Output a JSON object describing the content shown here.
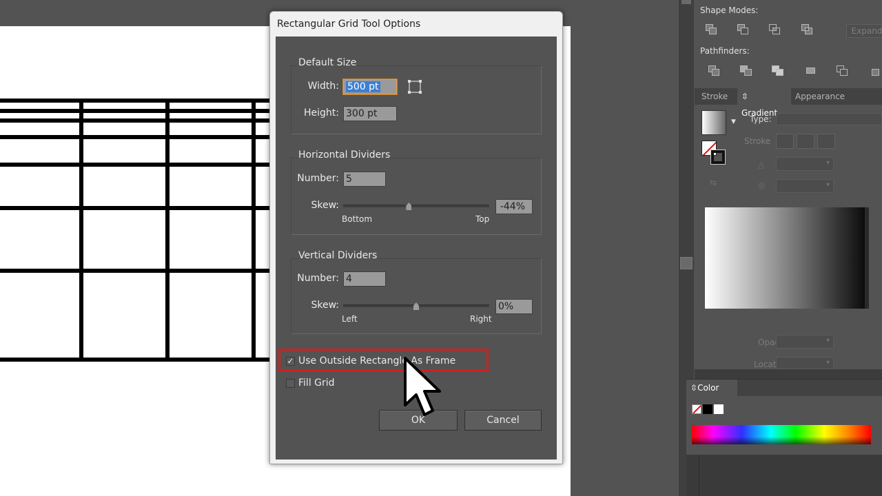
{
  "dialog": {
    "title": "Rectangular Grid Tool Options",
    "default_size": {
      "title": "Default Size",
      "width_label": "Width:",
      "width_value": "500 pt",
      "height_label": "Height:",
      "height_value": "300 pt"
    },
    "horizontal_dividers": {
      "title": "Horizontal Dividers",
      "number_label": "Number:",
      "number_value": "5",
      "skew_label": "Skew:",
      "skew_value": "-44%",
      "skew_fraction": 0.45,
      "min_label": "Bottom",
      "max_label": "Top"
    },
    "vertical_dividers": {
      "title": "Vertical Dividers",
      "number_label": "Number:",
      "number_value": "4",
      "skew_label": "Skew:",
      "skew_value": "0%",
      "skew_fraction": 0.5,
      "min_label": "Left",
      "max_label": "Right"
    },
    "use_outside_rect": {
      "label": "Use Outside Rectangle As Frame",
      "checked": true
    },
    "fill_grid": {
      "label": "Fill Grid",
      "checked": false
    },
    "ok_label": "OK",
    "cancel_label": "Cancel",
    "highlight_color": "#d21f1f"
  },
  "pathfinder": {
    "shape_modes_label": "Shape Modes:",
    "pathfinders_label": "Pathfinders:",
    "expand_label": "Expand"
  },
  "gradient_panel": {
    "tabs": [
      "Stroke",
      "Gradient",
      "Appearance"
    ],
    "active_tab": "Gradient",
    "type_label": "Type:",
    "stroke_label": "Stroke",
    "opacity_label": "Opacity:",
    "location_label": "Location:"
  },
  "color_panel": {
    "tab_label": "Color"
  },
  "icons": [
    "grid-proportion-icon",
    "unite-icon",
    "minus-front-icon",
    "intersect-icon",
    "exclude-icon",
    "divide-icon",
    "trim-icon",
    "merge-icon",
    "crop-icon",
    "outline-icon",
    "minus-back-icon",
    "cursor-arrow-icon"
  ]
}
